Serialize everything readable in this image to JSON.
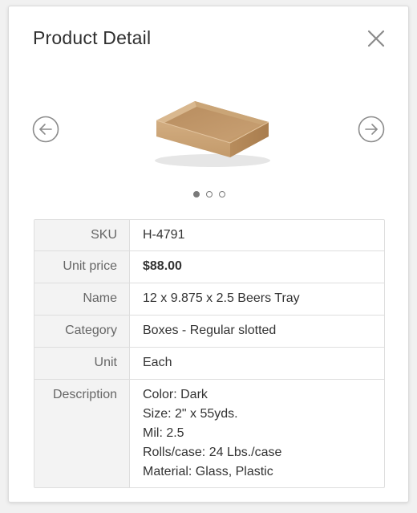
{
  "dialog": {
    "title": "Product Detail"
  },
  "carousel": {
    "image_alt": "cardboard tray",
    "slide_count": 3,
    "active_slide": 1,
    "icons": {
      "prev": "arrow-left-circle-icon",
      "next": "arrow-right-circle-icon",
      "close": "close-icon"
    }
  },
  "details": {
    "rows": [
      {
        "label": "SKU",
        "value": "H-4791"
      },
      {
        "label": "Unit price",
        "value": "$88.00"
      },
      {
        "label": "Name",
        "value": "12 x 9.875 x 2.5 Beers Tray"
      },
      {
        "label": "Category",
        "value": "Boxes - Regular slotted"
      },
      {
        "label": "Unit",
        "value": "Each"
      }
    ],
    "description": {
      "label": "Description",
      "lines": [
        "Color: Dark",
        "Size: 2\" x 55yds.",
        "Mil: 2.5",
        "Rolls/case: 24 Lbs./case",
        "Material: Glass, Plastic"
      ]
    }
  },
  "colors": {
    "text_primary": "#333333",
    "text_label": "#666666",
    "label_background": "#f3f3f3",
    "border": "#dedede",
    "icon": "#888888"
  }
}
